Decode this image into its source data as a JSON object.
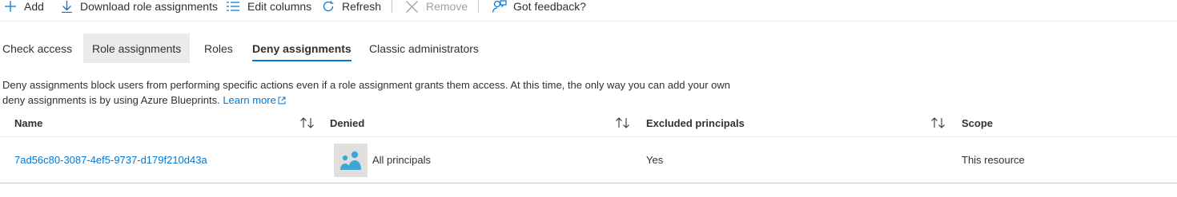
{
  "toolbar": {
    "add": "Add",
    "download": "Download role assignments",
    "edit_columns": "Edit columns",
    "refresh": "Refresh",
    "remove": "Remove",
    "feedback": "Got feedback?"
  },
  "tabs": [
    {
      "label": "Check access"
    },
    {
      "label": "Role assignments"
    },
    {
      "label": "Roles"
    },
    {
      "label": "Deny assignments"
    },
    {
      "label": "Classic administrators"
    }
  ],
  "active_tab": "Deny assignments",
  "description": {
    "text": "Deny assignments block users from performing specific actions even if a role assignment grants them access. At this time, the only way you can add your own deny assignments is by using Azure Blueprints.",
    "link": "Learn more"
  },
  "table": {
    "columns": [
      "Name",
      "Denied",
      "Excluded principals",
      "Scope"
    ],
    "rows": [
      {
        "name": "7ad56c80-3087-4ef5-9737-d179f210d43a",
        "denied": "All principals",
        "excluded": "Yes",
        "scope": "This resource"
      }
    ]
  },
  "colors": {
    "accent": "#0078d4",
    "text": "#323130",
    "disabled": "#a19f9d",
    "divider": "#edebe9",
    "tab_hover_bg": "#edebe9",
    "avatar_bg": "#e1dfdd",
    "avatar_icon": "#3fa7d6"
  },
  "icons": {
    "add": "plus-icon",
    "download": "download-icon",
    "edit_columns": "columns-icon",
    "refresh": "refresh-icon",
    "remove": "close-icon",
    "feedback": "feedback-person-icon",
    "sort": "sort-arrows-icon",
    "external": "external-link-icon",
    "group": "group-icon"
  }
}
